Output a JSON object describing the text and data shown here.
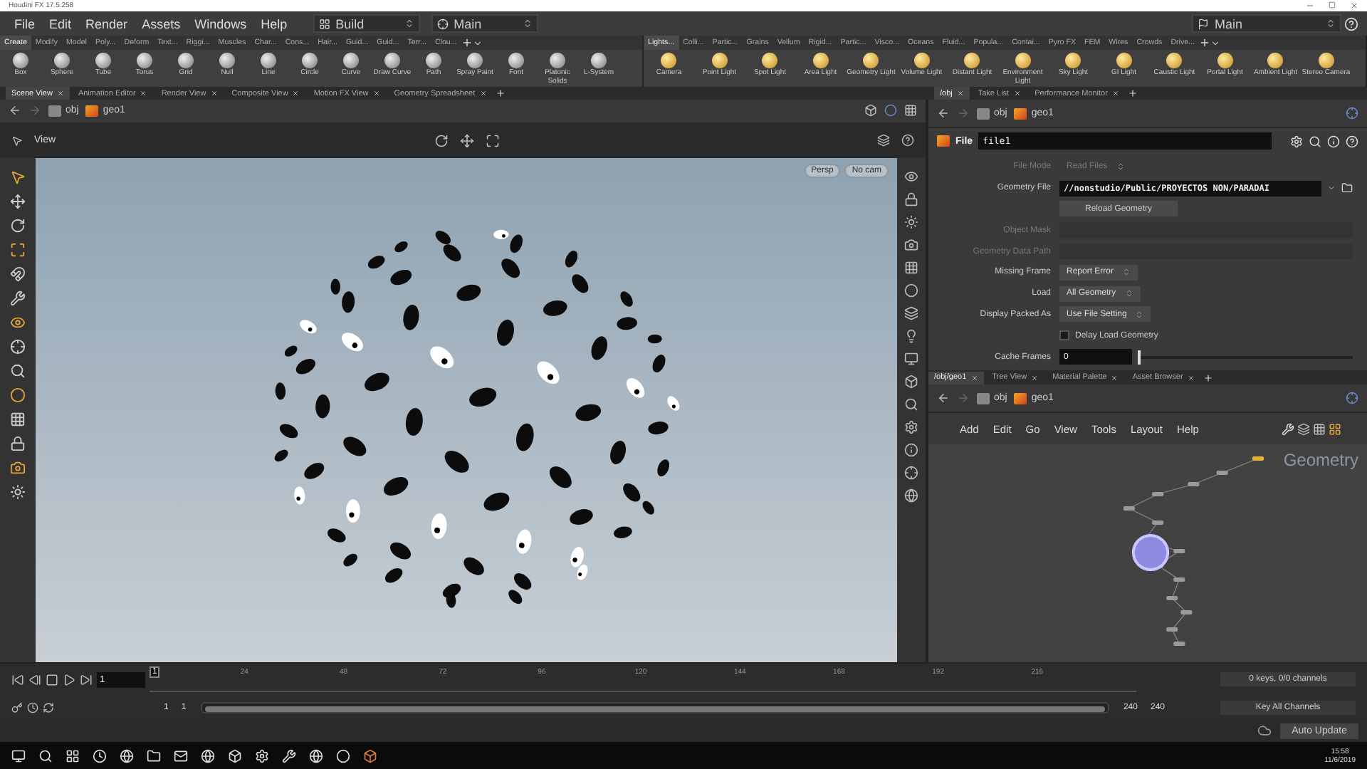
{
  "window": {
    "title": "Houdini FX 17.5.258"
  },
  "menu": [
    "File",
    "Edit",
    "Render",
    "Assets",
    "Windows",
    "Help"
  ],
  "desktop": {
    "value": "Build"
  },
  "view_left": {
    "value": "Main"
  },
  "view_right": {
    "value": "Main"
  },
  "shelf_left": {
    "tabs": [
      {
        "label": "Create",
        "selected": true
      },
      {
        "label": "Modify",
        "selected": false
      },
      {
        "label": "Model",
        "selected": false
      },
      {
        "label": "Poly...",
        "selected": false
      },
      {
        "label": "Deform",
        "selected": false
      },
      {
        "label": "Text...",
        "selected": false
      },
      {
        "label": "Riggi...",
        "selected": false
      },
      {
        "label": "Muscles",
        "selected": false
      },
      {
        "label": "Char...",
        "selected": false
      },
      {
        "label": "Cons...",
        "selected": false
      },
      {
        "label": "Hair...",
        "selected": false
      },
      {
        "label": "Guid...",
        "selected": false
      },
      {
        "label": "Guid...",
        "selected": false
      },
      {
        "label": "Terr...",
        "selected": false
      },
      {
        "label": "Clou...",
        "selected": false
      }
    ],
    "tools": [
      "Box",
      "Sphere",
      "Tube",
      "Torus",
      "Grid",
      "Null",
      "Line",
      "Circle",
      "Curve",
      "Draw Curve",
      "Path",
      "Spray Paint",
      "Font",
      "Platonic Solids",
      "L-System"
    ]
  },
  "shelf_right": {
    "tabs": [
      {
        "label": "Lights...",
        "selected": true
      },
      {
        "label": "Colli...",
        "selected": false
      },
      {
        "label": "Partic...",
        "selected": false
      },
      {
        "label": "Grains",
        "selected": false
      },
      {
        "label": "Vellum",
        "selected": false
      },
      {
        "label": "Rigid...",
        "selected": false
      },
      {
        "label": "Partic...",
        "selected": false
      },
      {
        "label": "Visco...",
        "selected": false
      },
      {
        "label": "Oceans",
        "selected": false
      },
      {
        "label": "Fluid...",
        "selected": false
      },
      {
        "label": "Popula...",
        "selected": false
      },
      {
        "label": "Contai...",
        "selected": false
      },
      {
        "label": "Pyro FX",
        "selected": false
      },
      {
        "label": "FEM",
        "selected": false
      },
      {
        "label": "Wires",
        "selected": false
      },
      {
        "label": "Crowds",
        "selected": false
      },
      {
        "label": "Drive...",
        "selected": false
      }
    ],
    "tools": [
      "Camera",
      "Point Light",
      "Spot Light",
      "Area Light",
      "Geometry Light",
      "Volume Light",
      "Distant Light",
      "Environment Light",
      "Sky Light",
      "GI Light",
      "Caustic Light",
      "Portal Light",
      "Ambient Light",
      "Stereo Camera"
    ]
  },
  "pane_tabs_left": [
    {
      "label": "Scene View",
      "selected": true
    },
    {
      "label": "Animation Editor",
      "selected": false
    },
    {
      "label": "Render View",
      "selected": false
    },
    {
      "label": "Composite View",
      "selected": false
    },
    {
      "label": "Motion FX View",
      "selected": false
    },
    {
      "label": "Geometry Spreadsheet",
      "selected": false
    }
  ],
  "pane_tabs_right": [
    {
      "label": "/obj",
      "selected": true
    },
    {
      "label": "Take List",
      "selected": false
    },
    {
      "label": "Performance Monitor",
      "selected": false
    }
  ],
  "scene_view": {
    "path": [
      "obj",
      "geo1"
    ],
    "toolbar_label": "View",
    "badges": [
      "Persp",
      "No cam"
    ]
  },
  "parameters": {
    "path": [
      "obj",
      "geo1"
    ],
    "node_type": "File",
    "node_name": "file1",
    "rows": [
      {
        "kind": "menu",
        "label": "File Mode",
        "value": "Read Files",
        "disabled": true
      },
      {
        "kind": "file",
        "label": "Geometry File",
        "value": "//nonstudio/Public/PROYECTOS NON/PARADAI",
        "disabled": false
      },
      {
        "kind": "button",
        "label": "Reload Geometry",
        "disabled": false
      },
      {
        "kind": "text",
        "label": "Object Mask",
        "disabled": true
      },
      {
        "kind": "text",
        "label": "Geometry Data Path",
        "disabled": true
      },
      {
        "kind": "menu",
        "label": "Missing Frame",
        "value": "Report Error",
        "disabled": false
      },
      {
        "kind": "menu",
        "label": "Load",
        "value": "All Geometry",
        "disabled": false
      },
      {
        "kind": "menu",
        "label": "Display Packed As",
        "value": "Use File Setting",
        "disabled": false
      },
      {
        "kind": "checkbox",
        "label": "Delay Load Geometry",
        "checked": false,
        "disabled": false
      },
      {
        "kind": "slider",
        "label": "Cache Frames",
        "value": "0",
        "level": 0,
        "disabled": false
      }
    ]
  },
  "network": {
    "tabs": [
      {
        "label": "/obj/geo1",
        "selected": true
      },
      {
        "label": "Tree View",
        "selected": false
      },
      {
        "label": "Material Palette",
        "selected": false
      },
      {
        "label": "Asset Browser",
        "selected": false
      }
    ],
    "path": [
      "obj",
      "geo1"
    ],
    "menu": [
      "Add",
      "Edit",
      "Go",
      "View",
      "Tools",
      "Layout",
      "Help"
    ],
    "context_label": "Geometry"
  },
  "timeline": {
    "frame": "1",
    "current_marker": "1",
    "ticks": [
      "24",
      "48",
      "72",
      "96",
      "120",
      "144",
      "168",
      "192",
      "216"
    ],
    "keys_status": "0 keys, 0/0 channels",
    "key_button": "Key All Channels",
    "range": [
      "1",
      "1",
      "240",
      "240"
    ],
    "range_slider": {
      "level": 1
    }
  },
  "status_bar": {
    "auto_update": "Auto Update"
  },
  "taskbar": {
    "time": "15:58",
    "date": "11/6/2019"
  }
}
